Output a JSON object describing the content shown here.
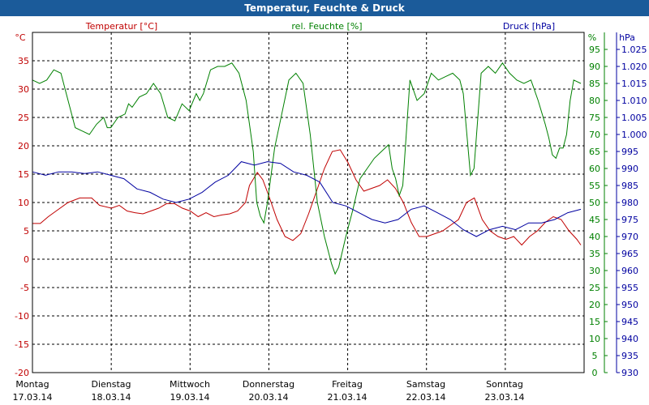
{
  "window": {
    "title": "Temperatur, Feuchte & Druck"
  },
  "chart_data": {
    "type": "line",
    "title": "Temperatur, Feuchte & Druck",
    "grid": true,
    "x_days": [
      {
        "weekday": "Montag",
        "date": "17.03.14"
      },
      {
        "weekday": "Dienstag",
        "date": "18.03.14"
      },
      {
        "weekday": "Mittwoch",
        "date": "19.03.14"
      },
      {
        "weekday": "Donnerstag",
        "date": "20.03.14"
      },
      {
        "weekday": "Freitag",
        "date": "21.03.14"
      },
      {
        "weekday": "Samstag",
        "date": "22.03.14"
      },
      {
        "weekday": "Sonntag",
        "date": "23.03.14"
      }
    ],
    "x_range_days": [
      0,
      7
    ],
    "axes": {
      "temperature": {
        "unit": "°C",
        "label": "Temperatur [°C]",
        "range": [
          -20,
          40
        ],
        "ticks": [
          -20,
          -15,
          -10,
          -5,
          0,
          5,
          10,
          15,
          20,
          25,
          30,
          35
        ],
        "color": "#c00000"
      },
      "humidity": {
        "unit": "%",
        "label": "rel. Feuchte [%]",
        "range": [
          0,
          100
        ],
        "ticks": [
          0,
          5,
          10,
          15,
          20,
          25,
          30,
          35,
          40,
          45,
          50,
          55,
          60,
          65,
          70,
          75,
          80,
          85,
          90,
          95
        ],
        "color": "#008000"
      },
      "pressure": {
        "unit": "hPa",
        "label": "Druck [hPa]",
        "range": [
          930,
          1030
        ],
        "ticks": [
          930,
          935,
          940,
          945,
          950,
          955,
          960,
          965,
          970,
          975,
          980,
          985,
          990,
          995,
          1000,
          1005,
          1010,
          1015,
          1020,
          1025
        ],
        "color": "#0000a0"
      }
    },
    "series": [
      {
        "name": "Temperatur [°C]",
        "axis": "temperature",
        "color": "#c00000",
        "points": [
          [
            0,
            6.3
          ],
          [
            0.1,
            6.3
          ],
          [
            0.2,
            7.5
          ],
          [
            0.3,
            8.5
          ],
          [
            0.45,
            10.0
          ],
          [
            0.6,
            10.8
          ],
          [
            0.75,
            10.8
          ],
          [
            0.85,
            9.5
          ],
          [
            1.0,
            9.0
          ],
          [
            1.1,
            9.5
          ],
          [
            1.2,
            8.5
          ],
          [
            1.3,
            8.2
          ],
          [
            1.4,
            8.0
          ],
          [
            1.5,
            8.5
          ],
          [
            1.6,
            9.0
          ],
          [
            1.7,
            9.8
          ],
          [
            1.8,
            9.8
          ],
          [
            1.9,
            9.0
          ],
          [
            2.0,
            8.5
          ],
          [
            2.1,
            7.5
          ],
          [
            2.2,
            8.2
          ],
          [
            2.3,
            7.5
          ],
          [
            2.4,
            7.8
          ],
          [
            2.5,
            8.0
          ],
          [
            2.6,
            8.5
          ],
          [
            2.7,
            10.0
          ],
          [
            2.75,
            13.0
          ],
          [
            2.85,
            15.3
          ],
          [
            2.92,
            14.0
          ],
          [
            3.0,
            11.0
          ],
          [
            3.1,
            7.0
          ],
          [
            3.2,
            4.0
          ],
          [
            3.3,
            3.3
          ],
          [
            3.4,
            4.5
          ],
          [
            3.5,
            8.0
          ],
          [
            3.6,
            12.0
          ],
          [
            3.7,
            16.0
          ],
          [
            3.8,
            19.0
          ],
          [
            3.9,
            19.3
          ],
          [
            4.0,
            17.0
          ],
          [
            4.1,
            14.0
          ],
          [
            4.2,
            12.0
          ],
          [
            4.3,
            12.5
          ],
          [
            4.4,
            13.0
          ],
          [
            4.5,
            14.0
          ],
          [
            4.6,
            12.5
          ],
          [
            4.7,
            10.0
          ],
          [
            4.8,
            6.5
          ],
          [
            4.9,
            4.0
          ],
          [
            5.0,
            4.0
          ],
          [
            5.1,
            4.5
          ],
          [
            5.2,
            5.0
          ],
          [
            5.3,
            6.0
          ],
          [
            5.4,
            7.0
          ],
          [
            5.5,
            10.0
          ],
          [
            5.6,
            10.8
          ],
          [
            5.7,
            7.0
          ],
          [
            5.8,
            5.0
          ],
          [
            5.9,
            4.0
          ],
          [
            6.0,
            3.5
          ],
          [
            6.1,
            4.0
          ],
          [
            6.2,
            2.5
          ],
          [
            6.3,
            4.0
          ],
          [
            6.4,
            5.0
          ],
          [
            6.5,
            6.5
          ],
          [
            6.6,
            7.5
          ],
          [
            6.7,
            7.0
          ],
          [
            6.8,
            5.0
          ],
          [
            6.9,
            3.5
          ],
          [
            6.95,
            2.5
          ]
        ]
      },
      {
        "name": "rel. Feuchte [%]",
        "axis": "humidity",
        "color": "#008000",
        "points": [
          [
            0,
            86
          ],
          [
            0.1,
            85
          ],
          [
            0.2,
            86
          ],
          [
            0.3,
            89
          ],
          [
            0.4,
            88
          ],
          [
            0.5,
            80
          ],
          [
            0.6,
            72
          ],
          [
            0.7,
            71
          ],
          [
            0.8,
            70
          ],
          [
            0.9,
            73
          ],
          [
            1.0,
            75
          ],
          [
            1.05,
            72
          ],
          [
            1.1,
            72
          ],
          [
            1.2,
            75
          ],
          [
            1.3,
            76
          ],
          [
            1.35,
            79
          ],
          [
            1.4,
            78
          ],
          [
            1.5,
            81
          ],
          [
            1.6,
            82
          ],
          [
            1.7,
            85
          ],
          [
            1.8,
            82
          ],
          [
            1.9,
            75
          ],
          [
            2.0,
            74
          ],
          [
            2.1,
            79
          ],
          [
            2.2,
            77
          ],
          [
            2.3,
            82
          ],
          [
            2.35,
            80
          ],
          [
            2.4,
            82
          ],
          [
            2.5,
            89
          ],
          [
            2.6,
            90
          ],
          [
            2.7,
            90
          ],
          [
            2.8,
            91
          ],
          [
            2.9,
            88
          ],
          [
            3.0,
            80
          ],
          [
            3.1,
            65
          ],
          [
            3.15,
            50
          ],
          [
            3.2,
            46
          ],
          [
            3.25,
            44
          ],
          [
            3.3,
            50
          ],
          [
            3.4,
            66
          ],
          [
            3.5,
            76
          ],
          [
            3.6,
            86
          ],
          [
            3.7,
            88
          ],
          [
            3.8,
            85
          ],
          [
            3.9,
            70
          ],
          [
            4.0,
            50
          ],
          [
            4.1,
            40
          ],
          [
            4.2,
            32
          ],
          [
            4.25,
            29
          ],
          [
            4.3,
            31
          ],
          [
            4.4,
            40
          ],
          [
            4.5,
            48
          ],
          [
            4.6,
            57
          ],
          [
            4.7,
            60
          ],
          [
            4.8,
            63
          ],
          [
            4.9,
            65
          ],
          [
            5.0,
            67
          ],
          [
            5.05,
            60
          ],
          [
            5.1,
            57
          ],
          [
            5.15,
            52
          ],
          [
            5.2,
            55
          ],
          [
            5.3,
            86
          ],
          [
            5.4,
            80
          ],
          [
            5.5,
            82
          ],
          [
            5.6,
            88
          ],
          [
            5.7,
            86
          ],
          [
            5.8,
            87
          ],
          [
            5.9,
            88
          ],
          [
            6.0,
            86
          ],
          [
            6.05,
            82
          ],
          [
            6.1,
            70
          ],
          [
            6.15,
            58
          ],
          [
            6.2,
            60
          ],
          [
            6.3,
            88
          ],
          [
            6.4,
            90
          ],
          [
            6.5,
            88
          ],
          [
            6.6,
            91
          ],
          [
            6.7,
            88
          ],
          [
            6.8,
            86
          ],
          [
            6.9,
            85
          ],
          [
            7.0,
            86
          ],
          [
            7.1,
            80
          ],
          [
            7.2,
            73
          ],
          [
            7.25,
            69
          ],
          [
            7.3,
            64
          ],
          [
            7.35,
            63
          ],
          [
            7.4,
            66
          ],
          [
            7.45,
            66
          ],
          [
            7.5,
            70
          ],
          [
            7.55,
            80
          ],
          [
            7.6,
            86
          ],
          [
            7.7,
            85
          ]
        ]
      },
      {
        "name": "Druck [hPa]",
        "axis": "pressure",
        "color": "#0000a0",
        "points": [
          [
            0,
            989
          ],
          [
            0.2,
            988
          ],
          [
            0.4,
            989
          ],
          [
            0.6,
            989
          ],
          [
            0.8,
            988.5
          ],
          [
            1.0,
            989
          ],
          [
            1.2,
            988
          ],
          [
            1.4,
            987
          ],
          [
            1.6,
            984
          ],
          [
            1.8,
            983
          ],
          [
            2.0,
            981
          ],
          [
            2.2,
            980
          ],
          [
            2.4,
            981
          ],
          [
            2.6,
            983
          ],
          [
            2.8,
            986
          ],
          [
            3.0,
            988
          ],
          [
            3.2,
            992
          ],
          [
            3.4,
            991
          ],
          [
            3.6,
            992
          ],
          [
            3.8,
            991.5
          ],
          [
            4.0,
            989
          ],
          [
            4.2,
            988
          ],
          [
            4.4,
            986
          ],
          [
            4.6,
            980
          ],
          [
            4.8,
            979
          ],
          [
            5.0,
            977
          ],
          [
            5.2,
            975
          ],
          [
            5.4,
            974
          ],
          [
            5.6,
            975
          ],
          [
            5.8,
            978
          ],
          [
            6.0,
            979
          ],
          [
            6.2,
            977
          ],
          [
            6.4,
            975
          ],
          [
            6.6,
            972
          ],
          [
            6.8,
            970
          ],
          [
            7.0,
            972
          ],
          [
            7.2,
            973
          ],
          [
            7.4,
            972
          ],
          [
            7.6,
            974
          ],
          [
            7.8,
            974
          ],
          [
            8.0,
            975
          ],
          [
            8.2,
            977
          ],
          [
            8.4,
            978
          ]
        ]
      }
    ]
  }
}
